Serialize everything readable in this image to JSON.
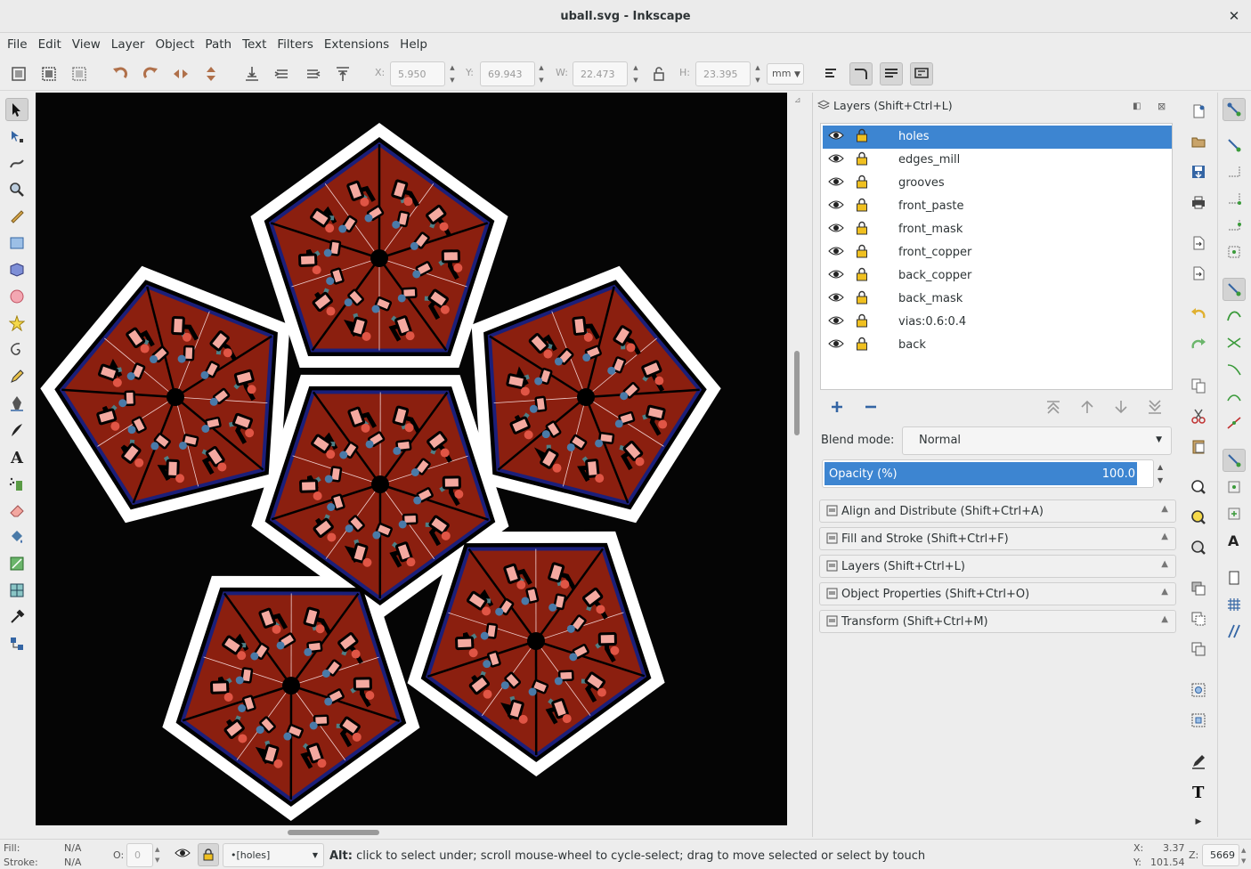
{
  "window": {
    "title": "uball.svg - Inkscape",
    "close_glyph": "✕"
  },
  "menu": [
    "File",
    "Edit",
    "View",
    "Layer",
    "Object",
    "Path",
    "Text",
    "Filters",
    "Extensions",
    "Help"
  ],
  "controls": {
    "x_label": "X:",
    "x_value": "5.950",
    "y_label": "Y:",
    "y_value": "69.943",
    "w_label": "W:",
    "w_value": "22.473",
    "h_label": "H:",
    "h_value": "23.395",
    "unit": "mm"
  },
  "layers_panel": {
    "title": "Layers (Shift+Ctrl+L)",
    "layers": [
      {
        "name": "holes",
        "selected": true
      },
      {
        "name": "edges_mill",
        "selected": false
      },
      {
        "name": "grooves",
        "selected": false
      },
      {
        "name": "front_paste",
        "selected": false
      },
      {
        "name": "front_mask",
        "selected": false
      },
      {
        "name": "front_copper",
        "selected": false
      },
      {
        "name": "back_copper",
        "selected": false
      },
      {
        "name": "back_mask",
        "selected": false
      },
      {
        "name": "vias:0.6:0.4",
        "selected": false
      },
      {
        "name": "back",
        "selected": false
      }
    ],
    "blend_label": "Blend mode:",
    "blend_value": "Normal",
    "opacity_label": "Opacity (%)",
    "opacity_value": "100.0",
    "opacity_fraction": 0.96
  },
  "docks": [
    {
      "label": "Align and Distribute (Shift+Ctrl+A)",
      "icon": "align-icon"
    },
    {
      "label": "Fill and Stroke (Shift+Ctrl+F)",
      "icon": "fill-stroke-icon"
    },
    {
      "label": "Layers (Shift+Ctrl+L)",
      "icon": "layers-icon"
    },
    {
      "label": "Object Properties (Shift+Ctrl+O)",
      "icon": "object-properties-icon"
    },
    {
      "label": "Transform (Shift+Ctrl+M)",
      "icon": "transform-icon"
    }
  ],
  "status": {
    "fill_label": "Fill:",
    "fill_value": "N/A",
    "stroke_label": "Stroke:",
    "stroke_value": "N/A",
    "opacity_label": "O:",
    "opacity_value": "0",
    "layer_select": "•[holes]",
    "message_bold": "Alt:",
    "message": " click to select under; scroll mouse-wheel to cycle-select; drag to move selected or select by touch",
    "x_label": "X:",
    "x_value": "3.37",
    "y_label": "Y:",
    "y_value": "101.54",
    "zoom_label": "Z:",
    "zoom_value": "5669"
  },
  "colors": {
    "accent": "#3d85d1",
    "board": "#8b1f0f",
    "canvas": "#050505",
    "pad": "#f4a9a0",
    "via": "#4a7aa8",
    "trace": "#0a0a0a",
    "edge": "#1b1f7a"
  }
}
